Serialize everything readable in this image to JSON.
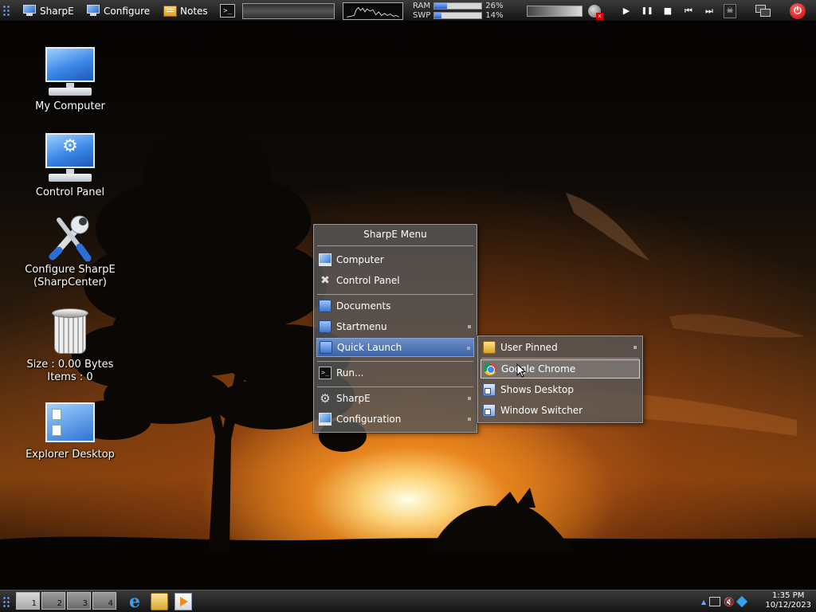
{
  "topbar": {
    "items": [
      {
        "label": "SharpE",
        "icon": "monitor-icon"
      },
      {
        "label": "Configure",
        "icon": "monitor-icon"
      },
      {
        "label": "Notes",
        "icon": "notes-icon"
      }
    ],
    "terminal_glyph": ">_",
    "meters": {
      "ram_label": "RAM",
      "swp_label": "SWP",
      "ram_pct": "26%",
      "swp_pct": "14%",
      "ram_value": 26,
      "swp_value": 14
    },
    "media_glyphs": {
      "play": "▶",
      "pause": "❚❚",
      "stop": "■",
      "prev": "⏮",
      "next": "⏭"
    },
    "power_glyph": "⏻"
  },
  "desktop": {
    "icons": [
      {
        "label": "My Computer",
        "icon": "computer-icon"
      },
      {
        "label": "Control Panel",
        "icon": "control-panel-icon"
      },
      {
        "label": "Configure SharpE",
        "label2": "(SharpCenter)",
        "icon": "tools-icon"
      },
      {
        "label": "Size : 0.00 Bytes",
        "label2": "Items : 0",
        "icon": "recycle-bin-icon"
      },
      {
        "label": "Explorer Desktop",
        "icon": "explorer-desktop-icon"
      }
    ]
  },
  "menu": {
    "title": "SharpE Menu",
    "items": [
      {
        "label": "Computer",
        "icon": "monitor-icon"
      },
      {
        "label": "Control Panel",
        "icon": "tools-icon"
      },
      {
        "label": "Documents",
        "icon": "folder-icon"
      },
      {
        "label": "Startmenu",
        "icon": "folder-icon"
      },
      {
        "label": "Quick Launch",
        "icon": "folder-icon"
      },
      {
        "label": "Run...",
        "icon": "run-icon"
      },
      {
        "label": "SharpE",
        "icon": "gear-icon"
      },
      {
        "label": "Configuration",
        "icon": "monitor-icon"
      }
    ]
  },
  "submenu": {
    "items": [
      {
        "label": "User Pinned",
        "icon": "pinned-folder-icon"
      },
      {
        "label": "Google Chrome",
        "icon": "chrome-icon"
      },
      {
        "label": "Shows Desktop",
        "icon": "shortcut-icon"
      },
      {
        "label": "Window Switcher",
        "icon": "shortcut-icon"
      }
    ]
  },
  "taskbar": {
    "desktops": [
      "1",
      "2",
      "3",
      "4"
    ],
    "current_desktop": "1",
    "ie_glyph": "e",
    "tray_arrow": "▲",
    "clock_time": "1:35 PM",
    "clock_date": "10/12/2023"
  },
  "colors": {
    "menu_active": "#4a70b3",
    "accent_blue": "#3a7ad8",
    "power_red": "#c40000"
  }
}
